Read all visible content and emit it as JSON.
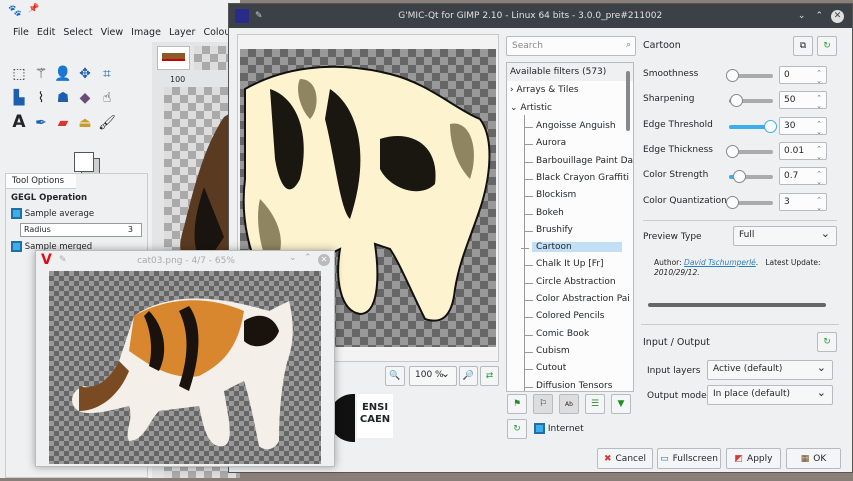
{
  "gimp": {
    "menu": [
      "File",
      "Edit",
      "Select",
      "View",
      "Image",
      "Layer",
      "Colours"
    ],
    "tool_options_tab": "Tool Options",
    "gegl_operation": "GEGL Operation",
    "sample_average": "Sample average",
    "radius_label": "Radius",
    "radius_value": "3",
    "sample_merged": "Sample merged",
    "ruler_100": "100"
  },
  "gmic": {
    "title": "G'MIC-Qt for GIMP 2.10 - Linux 64 bits - 3.0.0_pre#211002",
    "search_placeholder": "Search",
    "available_filters": "Available filters (573)",
    "tree": [
      {
        "label": "Arrays & Tiles",
        "type": "folder",
        "expanded": false
      },
      {
        "label": "Artistic",
        "type": "folder",
        "expanded": true
      }
    ],
    "filters": [
      "Angoisse Anguish",
      "Aurora",
      "Barbouillage Paint Da",
      "Black Crayon Graffiti",
      "Blockism",
      "Bokeh",
      "Brushify",
      "Cartoon",
      "Chalk It Up [Fr]",
      "Circle Abstraction",
      "Color Abstraction Pai",
      "Colored Pencils",
      "Comic Book",
      "Cubism",
      "Cutout",
      "Diffusion Tensors"
    ],
    "selected_filter": "Cartoon",
    "zoom": "100 %",
    "internet_label": "Internet",
    "filter_title": "Cartoon",
    "params": [
      {
        "label": "Smoothness",
        "value": "0",
        "fraction": 0
      },
      {
        "label": "Sharpening",
        "value": "50",
        "fraction": 0.1
      },
      {
        "label": "Edge Threshold",
        "value": "30",
        "fraction": 1
      },
      {
        "label": "Edge Thickness",
        "value": "0.01",
        "fraction": 0
      },
      {
        "label": "Color Strength",
        "value": "0.7",
        "fraction": 0.18
      },
      {
        "label": "Color Quantization",
        "value": "3",
        "fraction": 0
      }
    ],
    "preview_type_label": "Preview Type",
    "preview_type_value": "Full",
    "author_label": "Author:",
    "author_name": "David Tschumperlé",
    "author_dot": ".",
    "latest_update_label": "Latest Update:",
    "latest_update_value": "2010/29/12.",
    "io_title": "Input / Output",
    "input_layers_label": "Input layers",
    "input_layers_value": "Active (default)",
    "output_mode_label": "Output mode",
    "output_mode_value": "In place (default)",
    "buttons": {
      "cancel": "Cancel",
      "fullscreen": "Fullscreen",
      "apply": "Apply",
      "ok": "OK"
    },
    "logo_text": [
      "ENSI",
      "CAEN"
    ]
  },
  "viewer": {
    "title": "cat03.png - 4/7 - 65%"
  }
}
